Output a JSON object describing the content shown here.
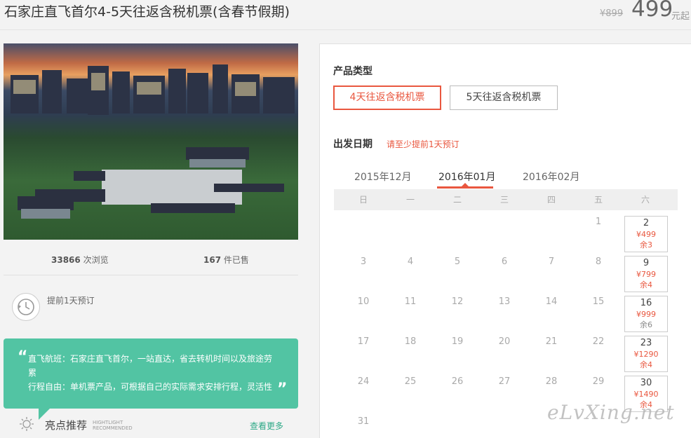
{
  "header": {
    "title": "石家庄直飞首尔4-5天往返含税机票(含春节假期)",
    "original_price": "¥899",
    "price": "499",
    "price_unit": "元起"
  },
  "stats": {
    "views_count": "33866",
    "views_label": "次浏览",
    "sold_count": "167",
    "sold_label": "件已售"
  },
  "advance": {
    "text": "提前1天预订",
    "icon": "clock-history-icon"
  },
  "bubble": {
    "open_quote": "“",
    "close_quote": "”",
    "line1": "直飞航班：石家庄直飞首尔，一站直达，省去转机时间以及旅途劳累",
    "line2": "行程自由：单机票产品，可根据自己的实际需求安排行程，灵活性",
    "color": "#52c4a3"
  },
  "highlight": {
    "label": "亮点推荐",
    "en1": "HIGHTLIGHT",
    "en2": "RECOMMENDED",
    "more": "查看更多",
    "icon": "sun-icon"
  },
  "booking": {
    "product_type_label": "产品类型",
    "product_types": [
      "4天往返含税机票",
      "5天往返含税机票"
    ],
    "selected_type": "4天往返含税机票",
    "date_label": "出发日期",
    "date_hint": "请至少提前1天预订",
    "months": [
      "2015年12月",
      "2016年01月",
      "2016年02月"
    ],
    "active_month": "2016年01月",
    "weekdays": [
      "日",
      "一",
      "二",
      "三",
      "四",
      "五",
      "六"
    ],
    "accent": "#e9573f"
  },
  "calendar": {
    "rows": [
      [
        "",
        "",
        "",
        "",
        "",
        "1"
      ],
      [
        "3",
        "4",
        "5",
        "6",
        "7",
        "8"
      ],
      [
        "10",
        "11",
        "12",
        "13",
        "14",
        "15"
      ],
      [
        "17",
        "18",
        "19",
        "20",
        "21",
        "22"
      ],
      [
        "24",
        "25",
        "26",
        "27",
        "28",
        "29"
      ],
      [
        "31",
        "",
        "",
        "",
        "",
        ""
      ]
    ],
    "available": [
      {
        "day": "2",
        "price": "¥499",
        "remain": "余3"
      },
      {
        "day": "9",
        "price": "¥799",
        "remain": "余4"
      },
      {
        "day": "16",
        "price": "¥999",
        "remain": "余6"
      },
      {
        "day": "23",
        "price": "¥1290",
        "remain": "余4"
      },
      {
        "day": "30",
        "price": "¥1490",
        "remain": "余4"
      }
    ]
  },
  "watermark": "eLvXing.net"
}
